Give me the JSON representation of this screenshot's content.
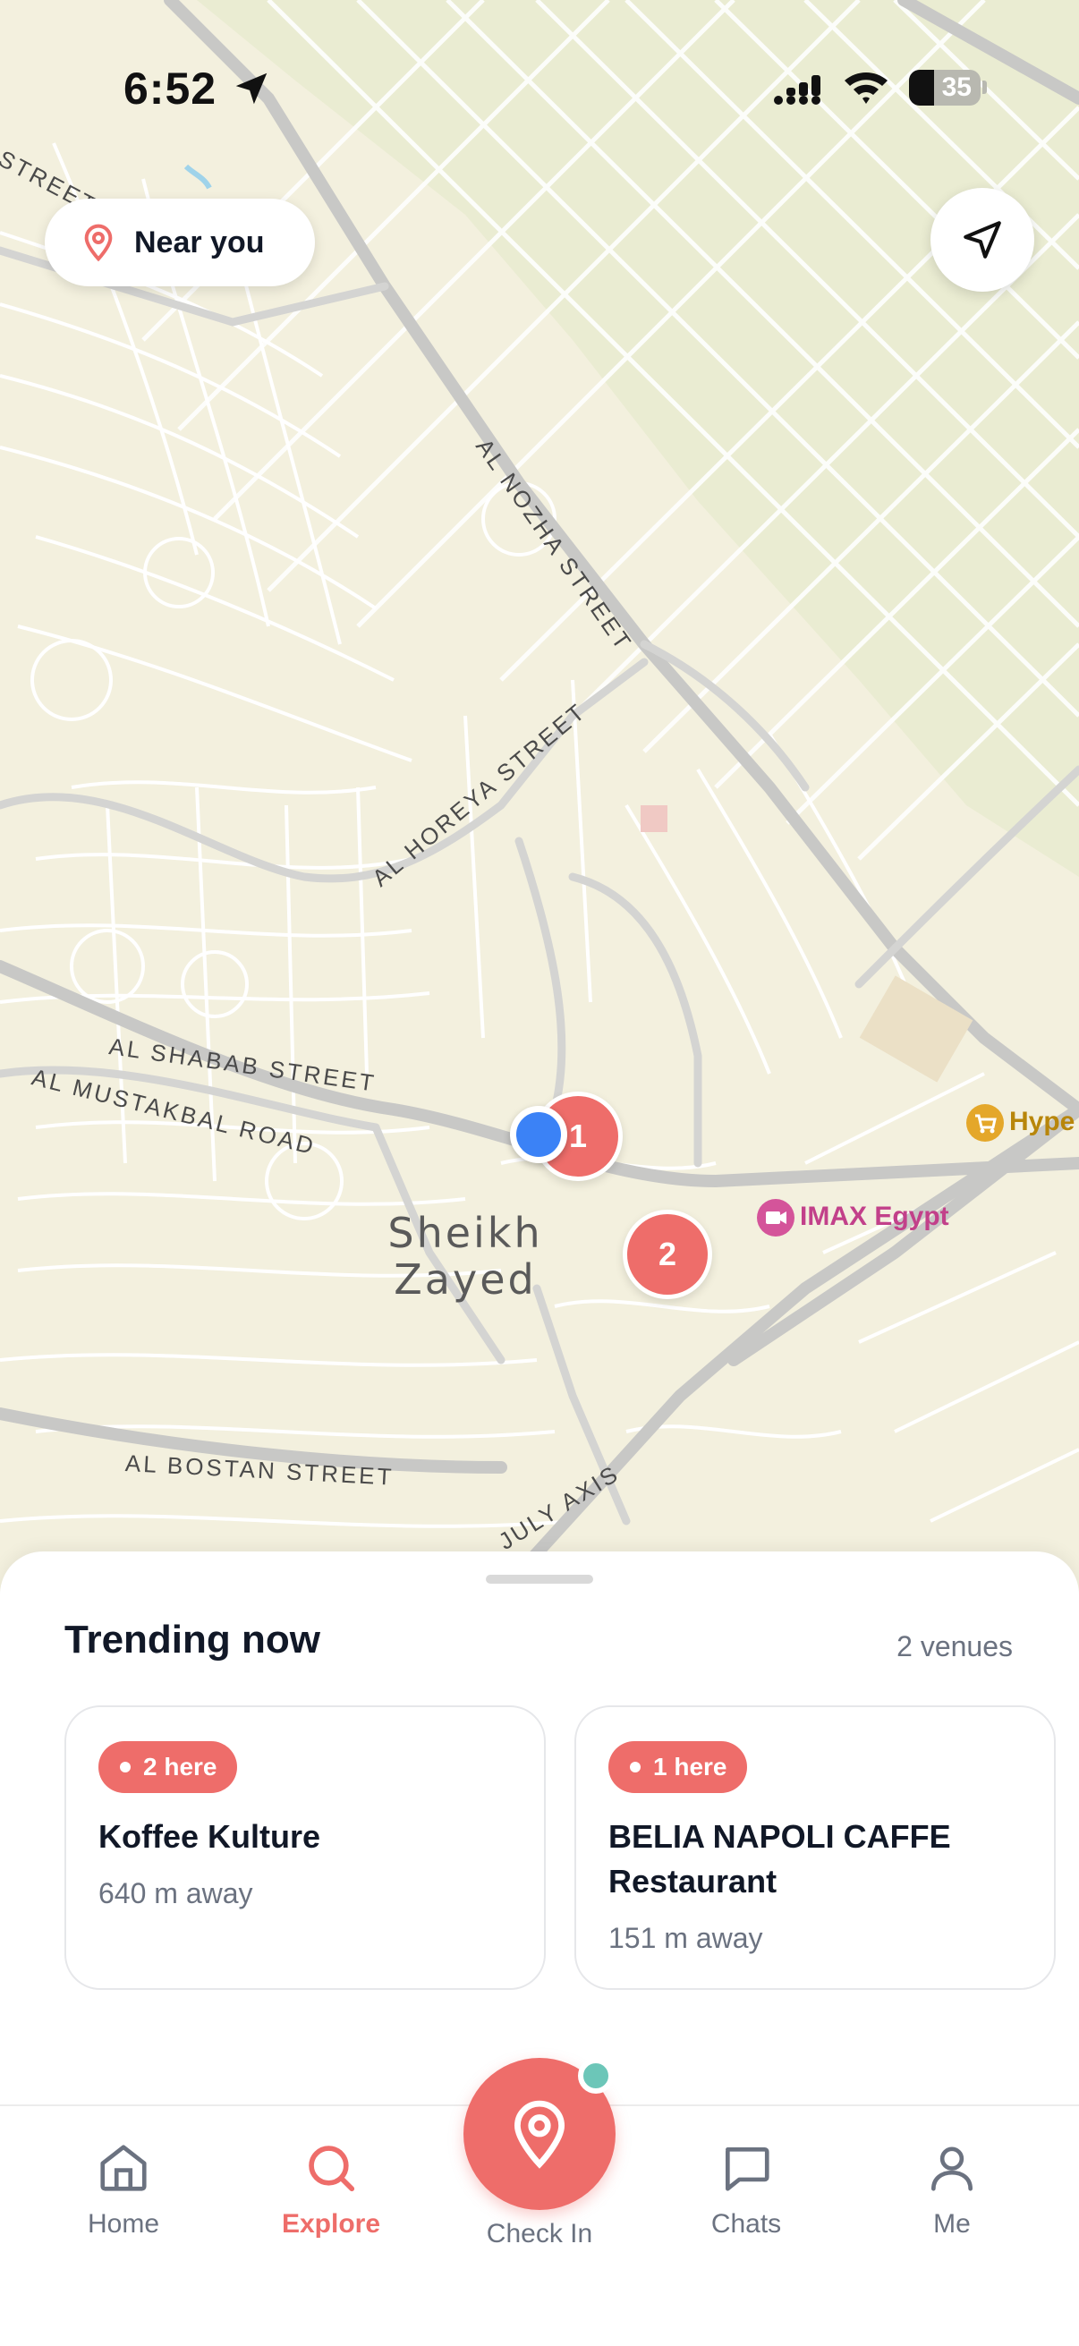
{
  "status_bar": {
    "time": "6:52",
    "battery": "35",
    "battery_level": 0.35
  },
  "map": {
    "near_you_label": "Near you",
    "streets": [
      "STREET",
      "AL NOZHA STREET",
      "AL HOREYA STREET",
      "AL SHABAB STREET",
      "AL MUSTAKBAL ROAD",
      "AL BOSTAN STREET",
      "JULY AXIS"
    ],
    "area_name": [
      "Sheikh",
      "Zayed"
    ],
    "pois": [
      {
        "name": "IMAX Egypt",
        "icon": "cinema-icon",
        "color": "#c2408a"
      },
      {
        "name": "Hype",
        "icon": "shopping-cart-icon",
        "color": "#b8860b"
      }
    ],
    "clusters": [
      "1",
      "2"
    ]
  },
  "sheet": {
    "title": "Trending now",
    "count": "2 venues",
    "venues": [
      {
        "badge": "2 here",
        "name": "Koffee Kulture",
        "distance": "640 m away"
      },
      {
        "badge": "1 here",
        "name": "BELIA NAPOLI CAFFE Restaurant",
        "distance": "151 m away"
      }
    ]
  },
  "tabbar": {
    "home": "Home",
    "explore": "Explore",
    "checkin": "Check In",
    "chats": "Chats",
    "me": "Me"
  },
  "colors": {
    "accent": "#ee6d6a",
    "user_dot": "#3b82f6",
    "notify_dot": "#6cc6b8"
  }
}
